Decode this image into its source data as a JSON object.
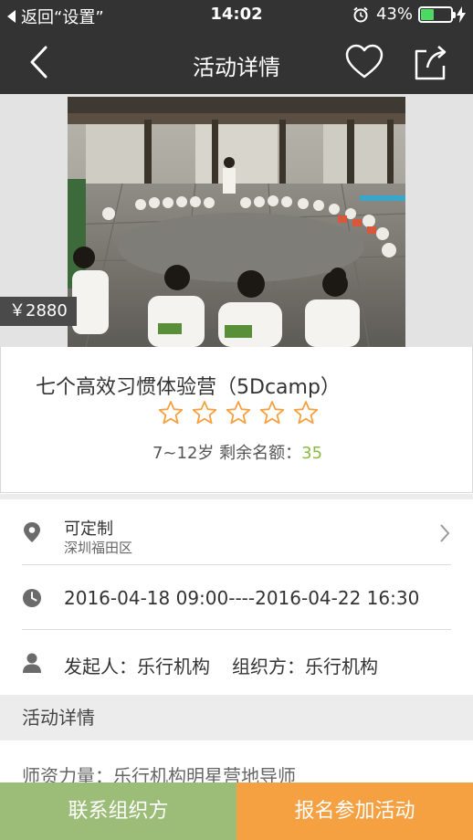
{
  "status_bar": {
    "back_text": "返回“设置”",
    "time": "14:02",
    "battery_percent": "43%",
    "battery_level": 0.43,
    "alarm_icon": "alarm-clock-icon",
    "charging_icon": "bolt-icon"
  },
  "nav": {
    "title": "活动详情",
    "back_icon": "chevron-left-icon",
    "favorite_icon": "heart-outline-icon",
    "share_icon": "share-icon"
  },
  "activity": {
    "price": "￥2880",
    "title": "七个高效习惯体验营（5Dcamp）",
    "rating": 0,
    "rating_max": 5,
    "age_text": "7~12岁  剩余名额：",
    "remaining": "35"
  },
  "location": {
    "title": "可定制",
    "district": "深圳福田区"
  },
  "time_range": "2016-04-18 09:00----2016-04-22 16:30",
  "organizer": {
    "initiator_label": "发起人：",
    "initiator": "乐行机构",
    "organizer_label": "组织方：",
    "organizer": "乐行机构"
  },
  "section": {
    "details_title": "活动详情",
    "teacher_text": "师资力量：乐行机构明星营地导师"
  },
  "actions": {
    "contact": "联系组织方",
    "signup": "报名参加活动"
  },
  "colors": {
    "header_bg": "#333333",
    "accent_green": "#9cbd78",
    "accent_orange": "#f5a142",
    "star": "#f5a142",
    "remaining_number": "#8cb843"
  }
}
